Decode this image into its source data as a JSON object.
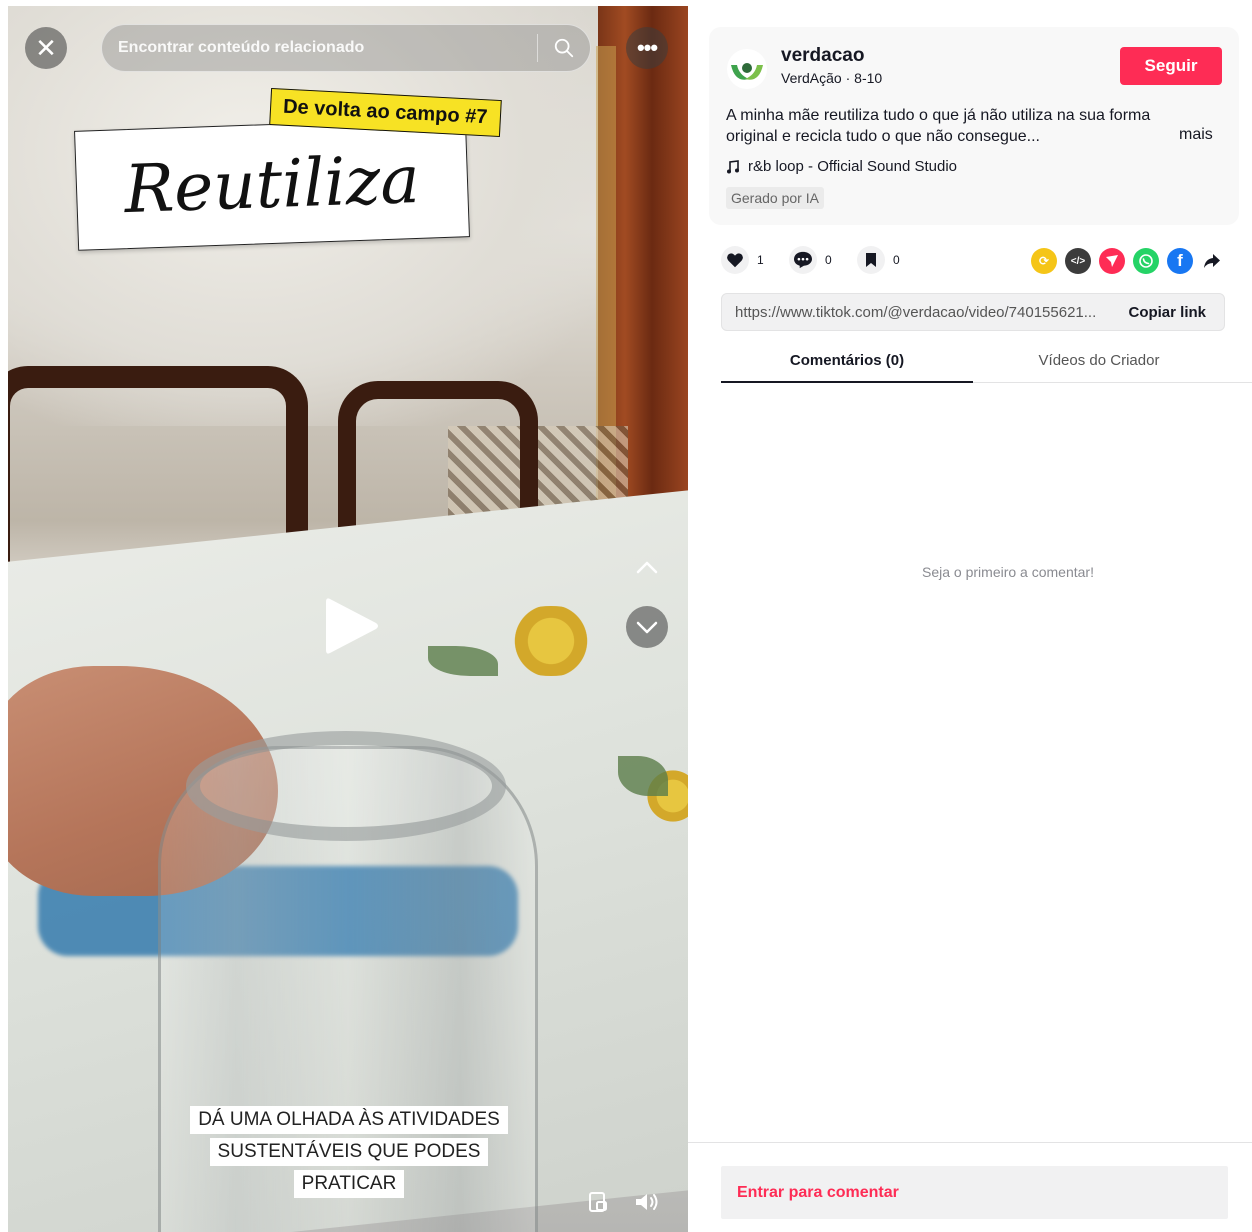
{
  "video": {
    "search_placeholder": "Encontrar conteúdo relacionado",
    "sticker_tag": "De volta ao campo #7",
    "sticker_title": "Reutiliza",
    "caption_lines": [
      "DÁ UMA OLHADA ÀS ATIVIDADES",
      "SUSTENTÁVEIS QUE PODES",
      "PRATICAR"
    ]
  },
  "author": {
    "username": "verdacao",
    "display_name": "VerdAção",
    "separator": " · ",
    "date": "8-10",
    "follow_label": "Seguir"
  },
  "post": {
    "description": "A minha mãe reutiliza tudo o que já não utiliza na sua forma original e recicla tudo o que não consegue...",
    "more_label": "mais",
    "music": "r&b loop - Official Sound Studio",
    "ai_badge": "Gerado por IA"
  },
  "stats": {
    "likes": "1",
    "comments": "0",
    "saves": "0"
  },
  "share": {
    "icons": [
      "repost-icon",
      "embed-icon",
      "send-icon",
      "whatsapp-icon",
      "facebook-icon",
      "share-arrow-icon"
    ],
    "colors": {
      "repost": "#f5c518",
      "embed": "#3c3c3c",
      "send": "#fe2c55",
      "whatsapp": "#25d366",
      "facebook": "#1877f2"
    }
  },
  "link": {
    "url": "https://www.tiktok.com/@verdacao/video/740155621...",
    "copy_label": "Copiar link"
  },
  "tabs": {
    "comments": "Comentários (0)",
    "creator_videos": "Vídeos do Criador"
  },
  "comments": {
    "empty_message": "Seja o primeiro a comentar!",
    "login_prompt": "Entrar para comentar"
  },
  "colors": {
    "accent": "#fe2c55",
    "text": "#161823"
  }
}
